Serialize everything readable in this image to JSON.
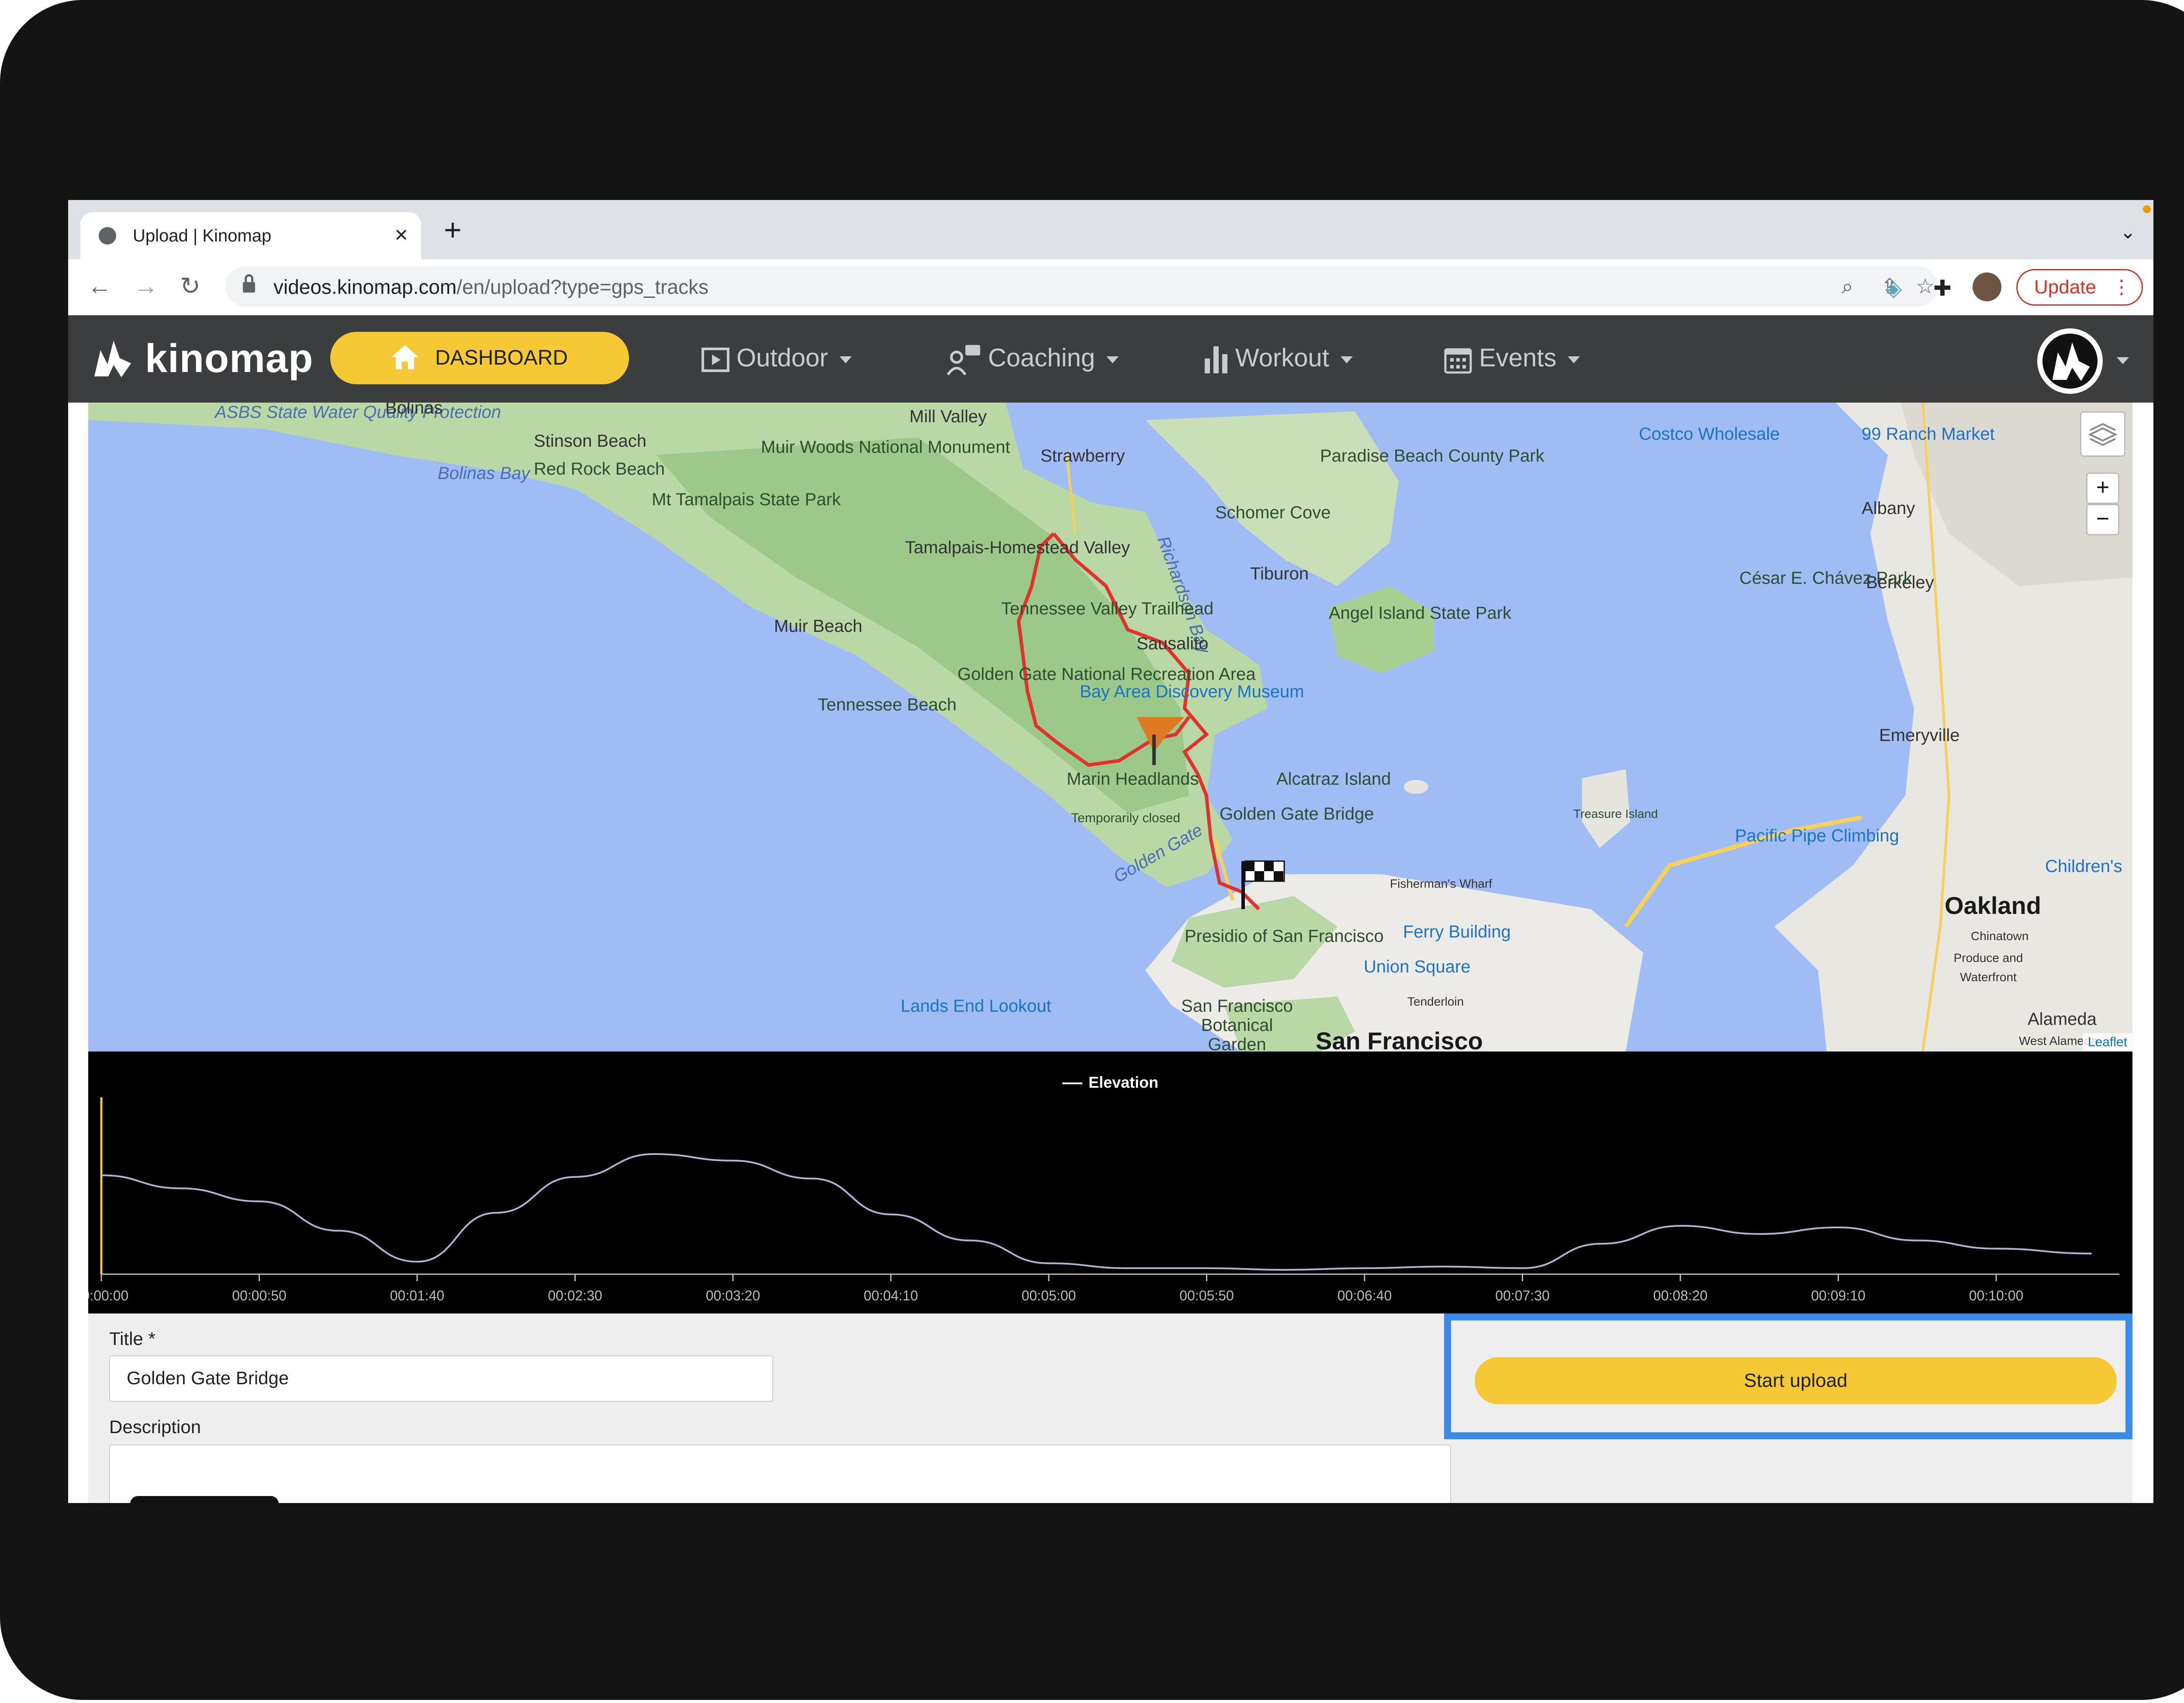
{
  "browser": {
    "tab_title": "Upload | Kinomap",
    "url_domain": "videos.kinomap.com",
    "url_path": "/en/upload?type=gps_tracks",
    "update_label": "Update"
  },
  "nav": {
    "brand": "kinomap",
    "dashboard_label": "DASHBOARD",
    "items": [
      {
        "label": "Outdoor",
        "icon": "play-icon"
      },
      {
        "label": "Coaching",
        "icon": "coach-icon"
      },
      {
        "label": "Workout",
        "icon": "bars-icon"
      },
      {
        "label": "Events",
        "icon": "calendar-icon"
      }
    ]
  },
  "map": {
    "labels": [
      "ASBS State Water Quality Protection",
      "Bolinas",
      "Stinson Beach",
      "Bolinas Bay",
      "Red Rock Beach",
      "Mt Tamalpais State Park",
      "Muir Woods National Monument",
      "Mill Valley",
      "Strawberry",
      "Paradise Beach County Park",
      "Costco Wholesale",
      "99 Ranch Market",
      "Albany",
      "Schomer Cove",
      "Richardson Bay",
      "Tamalpais-Homestead Valley",
      "Tiburon",
      "Berkeley",
      "César E. Chávez Park",
      "Muir Beach",
      "Tennessee Valley Trailhead",
      "Sausalito",
      "Angel Island State Park",
      "Golden Gate National Recreation Area",
      "Bay Area Discovery Museum",
      "Tennessee Beach",
      "Emeryville",
      "Marin Headlands",
      "Temporarily closed",
      "Alcatraz Island",
      "Golden Gate Bridge",
      "Golden Gate",
      "Treasure Island",
      "Pacific Pipe Climbing",
      "Children's",
      "Fisherman's Wharf",
      "Presidio of San Francisco",
      "Ferry Building",
      "Oakland",
      "Chinatown",
      "Union Square",
      "Tenderloin",
      "Produce and Waterfront",
      "Lands End Lookout",
      "San Francisco Botanical Garden",
      "San Francisco",
      "Alameda",
      "West Alameda"
    ],
    "zoom_in": "+",
    "zoom_out": "−",
    "attribution": "Leaflet"
  },
  "elevation_chart": {
    "legend": "Elevation",
    "ticks": [
      "00:00:00",
      "00:00:50",
      "00:01:40",
      "00:02:30",
      "00:03:20",
      "00:04:10",
      "00:05:00",
      "00:05:50",
      "00:06:40",
      "00:07:30",
      "00:08:20",
      "00:09:10",
      "00:10:00"
    ]
  },
  "chart_data": {
    "type": "line",
    "title": "",
    "xlabel": "",
    "ylabel": "",
    "legend_position": "top-center",
    "grid": false,
    "series": [
      {
        "name": "Elevation",
        "color": "#aab8d6",
        "x": [
          "00:00:00",
          "00:00:25",
          "00:00:50",
          "00:01:15",
          "00:01:40",
          "00:02:05",
          "00:02:30",
          "00:02:55",
          "00:03:20",
          "00:03:45",
          "00:04:10",
          "00:04:35",
          "00:05:00",
          "00:05:25",
          "00:05:50",
          "00:06:15",
          "00:06:40",
          "00:07:05",
          "00:07:30",
          "00:07:55",
          "00:08:20",
          "00:08:45",
          "00:09:10",
          "00:09:35",
          "00:10:00",
          "00:10:30"
        ],
        "values": [
          58,
          50,
          42,
          24,
          5,
          35,
          57,
          71,
          67,
          56,
          34,
          18,
          4,
          1,
          1,
          0,
          1,
          2,
          1,
          16,
          27,
          22,
          26,
          18,
          13,
          10
        ]
      }
    ]
  },
  "form": {
    "title_label": "Title *",
    "title_value": "Golden Gate Bridge",
    "description_label": "Description",
    "start_upload_label": "Start upload"
  },
  "colors": {
    "accent_yellow": "#f5c935",
    "header_bg": "#3b3d3f",
    "route_red": "#e0332c",
    "highlight_blue": "#3c8bea"
  }
}
